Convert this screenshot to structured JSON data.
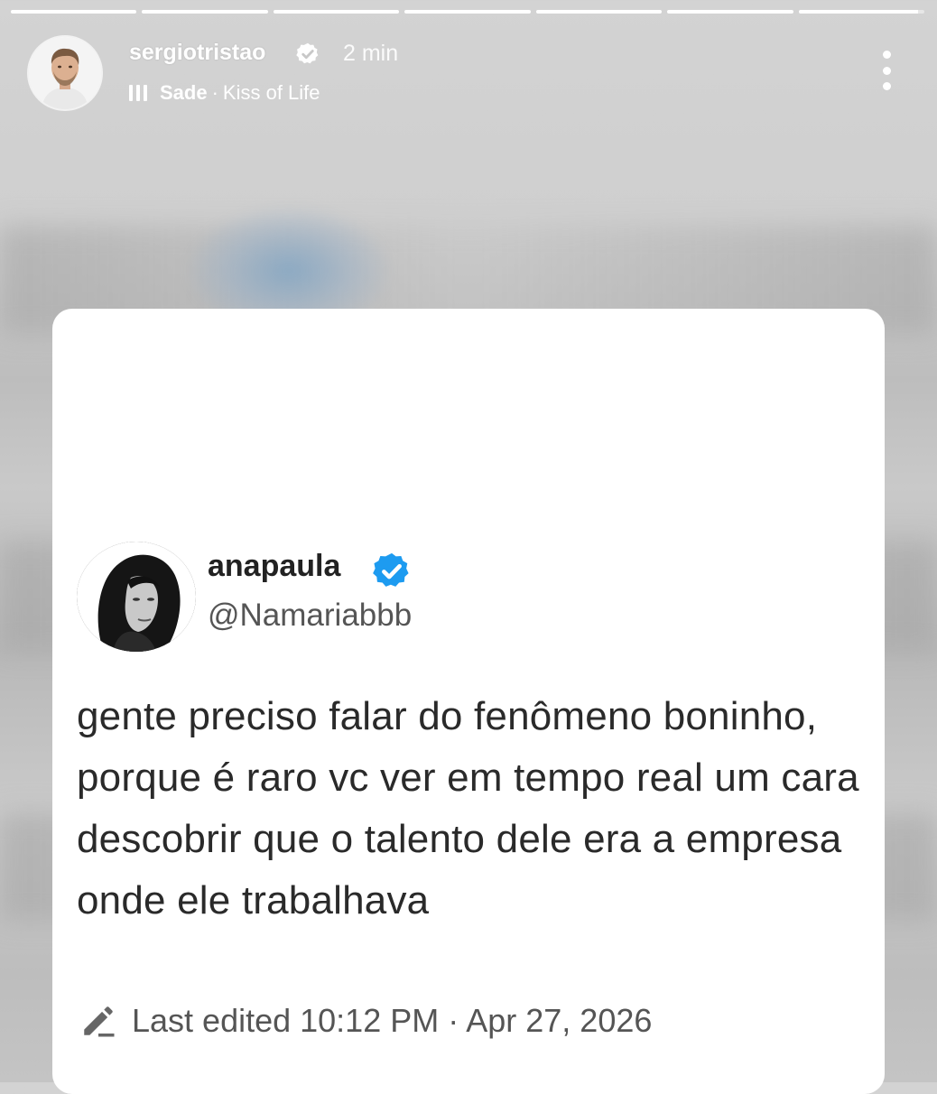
{
  "story": {
    "progress": {
      "segments": 7,
      "filled_fractions": [
        1,
        1,
        1,
        1,
        1,
        1,
        0.95
      ]
    },
    "header": {
      "username": "sergiotristao",
      "time": "2 min",
      "music": {
        "artist": "Sade",
        "separator": "·",
        "song": "Kiss of Life"
      }
    }
  },
  "tweet": {
    "name": "anapaula",
    "handle": "@Namariabbb",
    "text": "gente preciso falar do fenômeno boninho, porque é raro vc ver em tempo real um cara descobrir que o talento dele era a empresa onde ele trabalhava",
    "edited": "Last edited 10:12 PM · Apr 27, 2026"
  },
  "icons": {
    "verified_story": "verified-badge-icon",
    "verified_tweet": "verified-badge-icon",
    "music": "music-bars-icon",
    "more": "more-options-icon",
    "edit": "pencil-icon"
  },
  "colors": {
    "tweet_verified": "#1d9bf0",
    "story_text": "#ffffff",
    "card_bg": "#ffffff"
  }
}
